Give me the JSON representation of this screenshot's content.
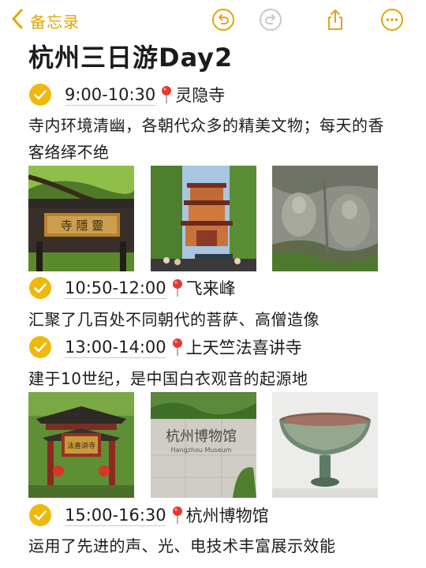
{
  "nav": {
    "back_label": "备忘录"
  },
  "toolbar": {
    "undo_icon": "undo-circle-icon",
    "redo_icon": "redo-circle-icon",
    "share_icon": "share-icon",
    "more_icon": "more-circle-icon"
  },
  "colors": {
    "accent": "#e2a50b",
    "check": "#f0b80c",
    "pin": "#e53935"
  },
  "note": {
    "title": "杭州三日游Day2",
    "items": [
      {
        "time": "9:00-10:30",
        "place": "灵隐寺",
        "desc": "寺内环境清幽，各朝代众多的精美文物；每天的香客络绎不绝",
        "photos": [
          "lingyin-temple-gate-plaque",
          "lingyin-temple-pagoda-hall",
          "feilaifeng-stone-carvings"
        ]
      },
      {
        "time": "10:50-12:00",
        "place": "飞来峰",
        "desc": "汇聚了几百处不同朝代的菩萨、高僧造像",
        "photos": []
      },
      {
        "time": "13:00-14:00",
        "place": "上天竺法喜讲寺",
        "desc": "建于10世纪，是中国白衣观音的起源地",
        "photos": [
          "faxi-temple-gate",
          "hangzhou-museum-sign",
          "celadon-stem-cup"
        ]
      },
      {
        "time": "15:00-16:30",
        "place": "杭州博物馆",
        "desc": "运用了先进的声、光、电技术丰富展示效能",
        "photos": []
      }
    ]
  }
}
